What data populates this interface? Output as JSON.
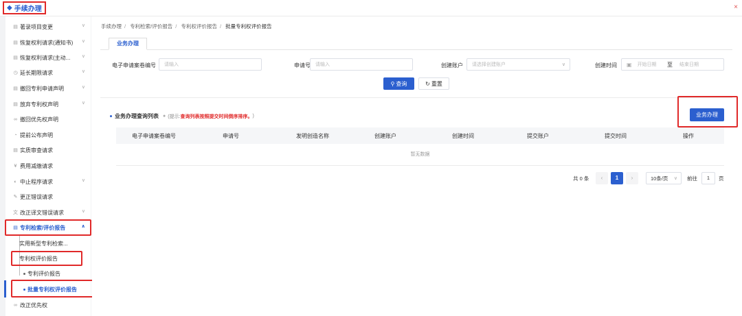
{
  "header": {
    "title": "手续办理",
    "close_icon": "close-icon"
  },
  "sidebar": {
    "items": [
      {
        "label": "著录项目变更",
        "icon": "file-icon",
        "has_children": true
      },
      {
        "label": "恢复权利请求(通知书)",
        "icon": "file-icon",
        "has_children": true
      },
      {
        "label": "恢复权利请求(主动...",
        "icon": "file-icon",
        "has_children": true
      },
      {
        "label": "延长期限请求",
        "icon": "clock-icon",
        "has_children": true
      },
      {
        "label": "撤回专利申请声明",
        "icon": "file-icon",
        "has_children": true
      },
      {
        "label": "放弃专利权声明",
        "icon": "file-icon",
        "has_children": true
      },
      {
        "label": "撤回优先权声明",
        "icon": "link-icon",
        "has_children": false
      },
      {
        "label": "提前公布声明",
        "icon": "bell-icon",
        "has_children": false
      },
      {
        "label": "实质审查请求",
        "icon": "file-icon",
        "has_children": false
      },
      {
        "label": "费用减缴请求",
        "icon": "money-icon",
        "has_children": false
      },
      {
        "label": "中止程序请求",
        "icon": "pause-icon",
        "has_children": true
      },
      {
        "label": "更正错误请求",
        "icon": "edit-icon",
        "has_children": false
      },
      {
        "label": "改正译文错误请求",
        "icon": "translate-icon",
        "has_children": true
      },
      {
        "label": "专利检索/评价报告",
        "icon": "report-icon",
        "has_children": true,
        "expanded": true
      }
    ],
    "sub_items": [
      {
        "label": "实用新型专利检索..."
      },
      {
        "label": "专利权评价报告"
      }
    ],
    "sub_sub_items": [
      {
        "label": "专利评价报告"
      },
      {
        "label": "批量专利权评价报告",
        "selected": true
      }
    ],
    "bottom_item": {
      "label": "改正优先权",
      "icon": "link-icon"
    }
  },
  "breadcrumb": [
    "手续办理",
    "专利检索/评价报告",
    "专利权评价报告",
    "批量专利权评价报告"
  ],
  "tab": {
    "label": "业务办理"
  },
  "filters": {
    "app_no_label": "电子申请案卷编号",
    "app_no_placeholder": "请输入",
    "apply_no_label": "申请号",
    "apply_no_placeholder": "请输入",
    "account_label": "创建账户",
    "account_placeholder": "请选择创建账户",
    "time_label": "创建时间",
    "start_placeholder": "开始日期",
    "range_sep": "至",
    "end_placeholder": "结束日期"
  },
  "buttons": {
    "search": "查询",
    "reset": "重置",
    "handle": "业务办理"
  },
  "list": {
    "title": "业务办理查询列表",
    "hint_prefix": "(提示:",
    "hint": "查询列表按照提交时间倒序排序。",
    "hint_suffix": ")",
    "columns": [
      "电子申请案卷编号",
      "申请号",
      "发明创造名称",
      "创建账户",
      "创建时间",
      "提交账户",
      "提交时间",
      "操作"
    ],
    "empty_text": "暂无数据"
  },
  "pagination": {
    "total_text": "共 0 条",
    "current_page": "1",
    "page_size": "10条/页",
    "goto_label": "前往",
    "goto_value": "1",
    "page_unit": "页"
  },
  "colors": {
    "primary": "#2b5fcf",
    "highlight": "#e02828"
  }
}
